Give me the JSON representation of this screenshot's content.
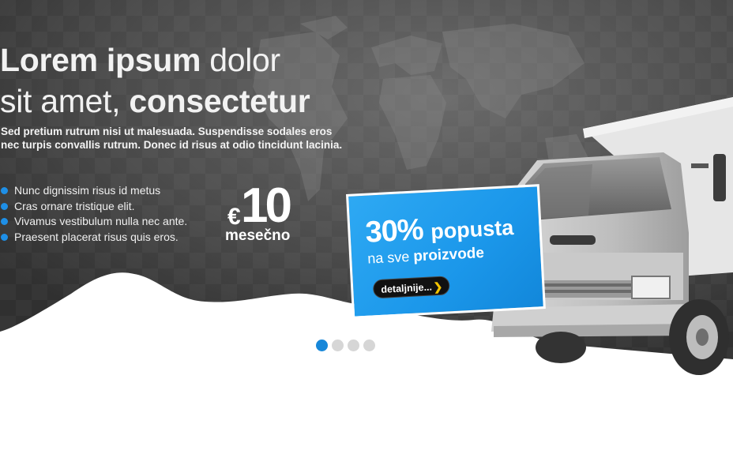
{
  "hero": {
    "headline": {
      "part1_bold": "Lorem ipsum",
      "part1_light": " dolor",
      "part2_light": "sit amet, ",
      "part2_bold": "consectetur"
    },
    "lead": "Sed pretium rutrum nisi ut malesuada. Suspendisse sodales eros nec turpis convallis rutrum. Donec id risus at odio tincidunt lacinia.",
    "bullets": [
      "Nunc dignissim risus id metus",
      "Cras ornare tristique elit.",
      "Vivamus vestibulum nulla nec ante.",
      "Praesent placerat risus quis eros."
    ],
    "price": {
      "currency": "€",
      "amount": "10",
      "period": "mesečno"
    }
  },
  "promo": {
    "percent": "30%",
    "word": "popusta",
    "sub_light": "na sve ",
    "sub_bold": "proizvode",
    "button_label": "detaljnije...",
    "button_icon": "chevron-right-icon"
  },
  "slider": {
    "count": 4,
    "active": 1
  },
  "colors": {
    "accent": "#1787d9",
    "promo_blue": "#1b97ea",
    "dot_inactive": "#d6d6d6",
    "chevron": "#f4c400"
  }
}
